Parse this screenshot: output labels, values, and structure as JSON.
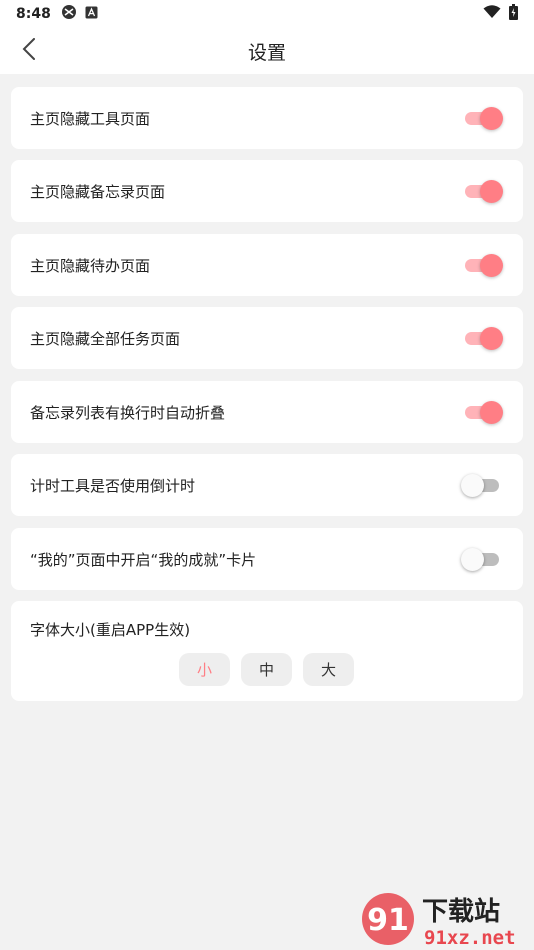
{
  "status_bar": {
    "time": "8:48"
  },
  "app_bar": {
    "title": "设置"
  },
  "settings": [
    {
      "label": "主页隐藏工具页面",
      "on": true
    },
    {
      "label": "主页隐藏备忘录页面",
      "on": true
    },
    {
      "label": "主页隐藏待办页面",
      "on": true
    },
    {
      "label": "主页隐藏全部任务页面",
      "on": true
    },
    {
      "label": "备忘录列表有换行时自动折叠",
      "on": true
    },
    {
      "label": "计时工具是否使用倒计时",
      "on": false
    },
    {
      "label": "“我的”页面中开启“我的成就”卡片",
      "on": false
    }
  ],
  "font_size": {
    "label": "字体大小(重启APP生效)",
    "options": [
      "小",
      "中",
      "大"
    ],
    "selected": "小"
  },
  "colors": {
    "accent": "#ff7e85",
    "accent_track": "#ffb3b8",
    "background": "#f2f2f2"
  },
  "watermark": {
    "logo": "91",
    "line1": "下载站",
    "line2": "91xz.net"
  }
}
